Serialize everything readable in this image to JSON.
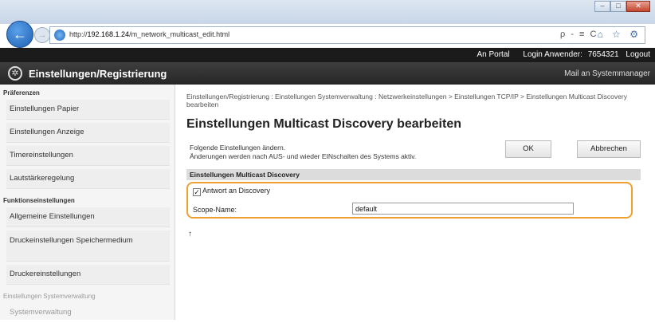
{
  "browser": {
    "url_prefix": "http://",
    "url_host": "192.168.1.24",
    "url_path": "/m_network_multicast_edit.html",
    "search_glyphs": "ρ - ≡ C",
    "window_buttons": [
      "–",
      "□",
      "✕"
    ],
    "back_glyph": "←",
    "forward_glyph": "→",
    "toolbar_icons": "⌂ ☆ ⚙"
  },
  "topbar": {
    "portal_link": "An Portal",
    "login_label": "Login Anwender:",
    "login_user": "7654321",
    "logout_link": "Logout"
  },
  "header": {
    "title": "Einstellungen/Registrierung",
    "mail_link": "Mail an Systemmanager"
  },
  "sidebar": {
    "section1": "Präferenzen",
    "items1": [
      "Einstellungen Papier",
      "Einstellungen Anzeige",
      "Timereinstellungen",
      "Lautstärkeregelung"
    ],
    "section2": "Funktionseinstellungen",
    "items2": [
      "Allgemeine Einstellungen",
      "Druckeinstellungen Speichermedium",
      "Druckereinstellungen"
    ],
    "section3": "Einstellungen Systemverwaltung",
    "items3": [
      "Systemverwaltung"
    ]
  },
  "main": {
    "breadcrumb": "Einstellungen/Registrierung : Einstellungen Systemverwaltung : Netzwerkeinstellungen > Einstellungen TCP/IP > Einstellungen Multicast Discovery bearbeiten",
    "title": "Einstellungen Multicast Discovery bearbeiten",
    "desc_line1": "Folgende Einstellungen ändern.",
    "desc_line2": "Änderungen werden nach AUS- und wieder EINschalten des Systems aktiv.",
    "ok_label": "OK",
    "cancel_label": "Abbrechen",
    "section_title": "Einstellungen Multicast Discovery",
    "checkbox_label": "Antwort an Discovery",
    "checkbox_checked": true,
    "scope_label": "Scope-Name:",
    "scope_value": "default",
    "to_top": "↑"
  }
}
